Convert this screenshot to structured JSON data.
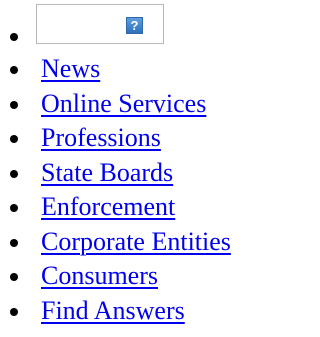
{
  "help_icon": {
    "glyph": "?",
    "icon": "help-icon"
  },
  "nav": {
    "items": [
      {
        "label": "News"
      },
      {
        "label": "Online Services"
      },
      {
        "label": "Professions"
      },
      {
        "label": "State Boards"
      },
      {
        "label": "Enforcement"
      },
      {
        "label": "Corporate Entities"
      },
      {
        "label": "Consumers"
      },
      {
        "label": "Find Answers"
      }
    ]
  },
  "colors": {
    "link": "#0000ee",
    "text": "#000000",
    "box_border": "#b9b9b9",
    "icon_fill": "#3f82cf"
  }
}
